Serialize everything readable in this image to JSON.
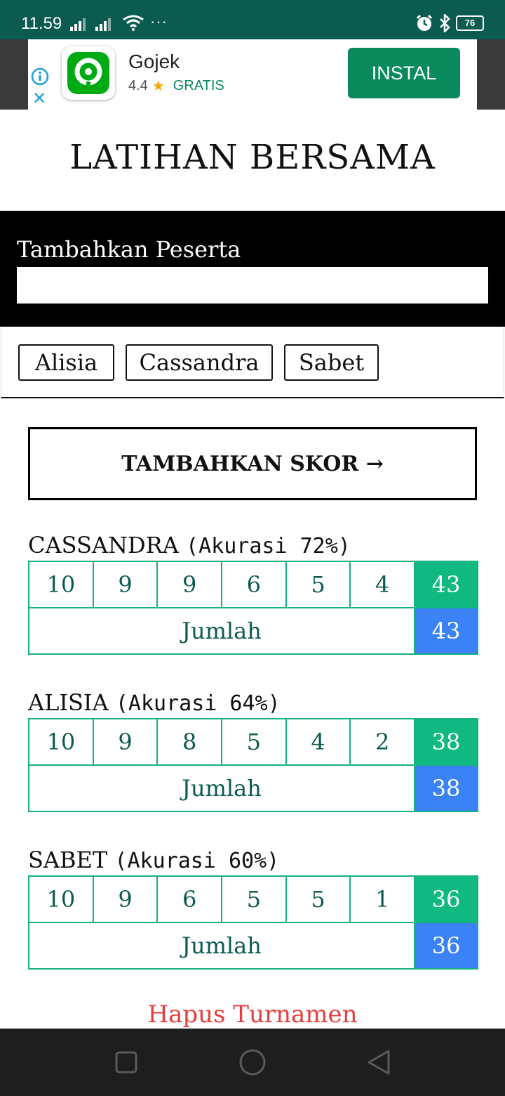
{
  "status_bar": {
    "time": "11.59",
    "more": "···",
    "battery": "76"
  },
  "ad": {
    "app_name": "Gojek",
    "rating": "4.4",
    "price": "GRATIS",
    "install_label": "INSTAL",
    "icon_color": "#00aa13"
  },
  "page": {
    "title": "LATIHAN BERSAMA"
  },
  "add_participant": {
    "label": "Tambahkan Peserta",
    "input_value": ""
  },
  "participants": [
    "Alisia",
    "Cassandra",
    "Sabet"
  ],
  "add_score_label": "TAMBAHKAN SKOR →",
  "players": [
    {
      "name": "CASSANDRA",
      "accuracy": "(Akurasi 72%)",
      "scores": [
        "10",
        "9",
        "9",
        "6",
        "5",
        "4"
      ],
      "round_total": "43",
      "sum_label": "Jumlah",
      "sum": "43"
    },
    {
      "name": "ALISIA",
      "accuracy": "(Akurasi 64%)",
      "scores": [
        "10",
        "9",
        "8",
        "5",
        "4",
        "2"
      ],
      "round_total": "38",
      "sum_label": "Jumlah",
      "sum": "38"
    },
    {
      "name": "SABET",
      "accuracy": "(Akurasi 60%)",
      "scores": [
        "10",
        "9",
        "6",
        "5",
        "5",
        "1"
      ],
      "round_total": "36",
      "sum_label": "Jumlah",
      "sum": "36"
    }
  ],
  "delete_label": "Hapus Turnamen",
  "colors": {
    "status_bar": "#0b5b50",
    "grid_border": "#16b180",
    "round_total_bg": "#10b981",
    "sum_bg": "#3b82f6",
    "delete_text": "#e53e3e",
    "install_bg": "#0a8a5c"
  }
}
